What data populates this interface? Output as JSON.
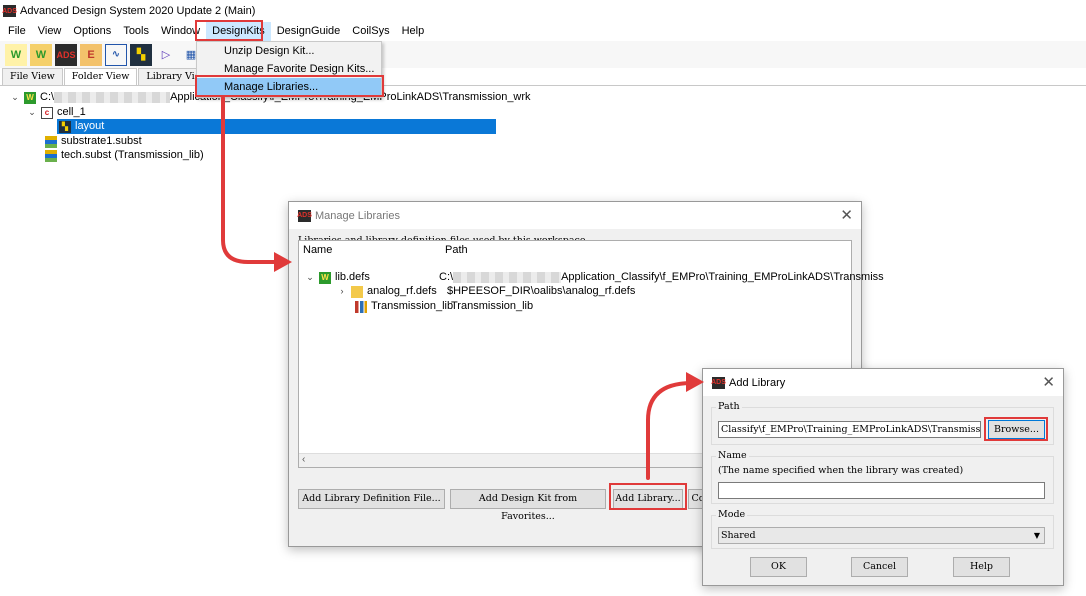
{
  "app": {
    "logo_text": "ADS",
    "title": "Advanced Design System 2020 Update 2 (Main)"
  },
  "menubar": [
    "File",
    "View",
    "Options",
    "Tools",
    "Window",
    "DesignKits",
    "DesignGuide",
    "CoilSys",
    "Help"
  ],
  "toolbar": {
    "icons": [
      "new-workspace-icon",
      "open-workspace-icon",
      "ads-schematic-icon",
      "em-icon",
      "waveform-icon",
      "layout-icon",
      "amplifier-icon",
      "generic-icon"
    ]
  },
  "tabs": [
    "File View",
    "Folder View",
    "Library View"
  ],
  "tree": {
    "root_prefix": "C:\\",
    "root_suffix": "Application_Classify\\f_EMPro\\Training_EMProLinkADS\\Transmission_wrk",
    "cell": "cell_1",
    "layout": "layout",
    "substrate1": "substrate1.subst",
    "tech": "tech.subst (Transmission_lib)"
  },
  "designkits_menu": {
    "items": [
      "Unzip Design Kit...",
      "Manage Favorite Design Kits...",
      "Manage Libraries..."
    ],
    "highlighted": "Manage Libraries..."
  },
  "manage_libraries": {
    "title": "Manage Libraries",
    "description": "Libraries and library definition files used by this workspace.",
    "col_name": "Name",
    "col_path": "Path",
    "rows": [
      {
        "name": "lib.defs",
        "path_prefix": "C:\\",
        "path_suffix": "Application_Classify\\f_EMPro\\Training_EMProLinkADS\\Transmiss"
      },
      {
        "name": "analog_rf.defs",
        "path": "$HPEESOF_DIR\\oalibs\\analog_rf.defs"
      },
      {
        "name": "Transmission_lib",
        "path": "Transmission_lib"
      }
    ],
    "buttons": [
      "Add Library Definition File...",
      "Add Design Kit from Favorites...",
      "Add Library...",
      "Co"
    ]
  },
  "add_library": {
    "title": "Add Library",
    "path_label": "Path",
    "path_value": "Classify\\f_EMPro\\Training_EMProLinkADS\\Transmission_wrk",
    "browse": "Browse...",
    "name_label": "Name",
    "name_hint": "(The name specified when the library was created)",
    "name_value": "",
    "mode_label": "Mode",
    "mode_value": "Shared",
    "ok": "OK",
    "cancel": "Cancel",
    "help": "Help"
  },
  "colors": {
    "selection": "#0a78d7",
    "menu_hover": "#91c9f7",
    "annotation_red": "#e03a3a"
  }
}
